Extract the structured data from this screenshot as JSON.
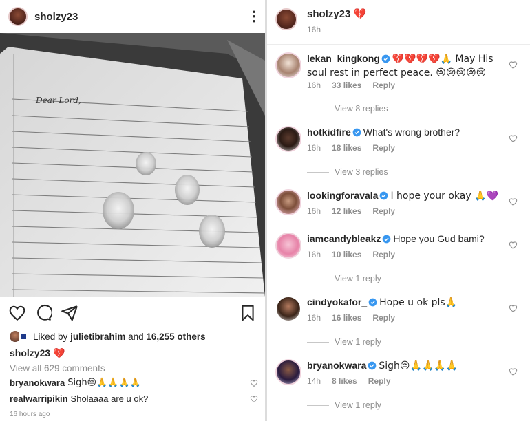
{
  "post": {
    "username": "sholzy23",
    "liked_prefix": "Liked by",
    "liked_user": "julietibrahim",
    "liked_and": "and",
    "liked_others": "16,255 others",
    "caption_user": "sholzy23",
    "caption_emoji": "💔",
    "view_all": "View all 629 comments",
    "preview_comments": [
      {
        "user": "bryanokwara",
        "text": "Sigh😔🙏🙏🙏🙏"
      },
      {
        "user": "realwarripikin",
        "text": "Sholaaaa are u ok?"
      }
    ],
    "time_ago": "16 hours ago",
    "photo_text": "Dear Lord,"
  },
  "detail": {
    "username": "sholzy23",
    "emoji": "💔",
    "time": "16h",
    "comments": [
      {
        "user": "lekan_kingkong",
        "text": "💔💔💔💔🙏 May His soul rest in perfect peace. 😢😢😢😢😢",
        "time": "16h",
        "likes": "33 likes",
        "reply": "Reply",
        "replies": "View 8 replies"
      },
      {
        "user": "hotkidfire",
        "text": "What's wrong brother?",
        "time": "16h",
        "likes": "18 likes",
        "reply": "Reply",
        "replies": "View 3 replies"
      },
      {
        "user": "lookingforavala",
        "text": "I hope your okay 🙏💜",
        "time": "16h",
        "likes": "12 likes",
        "reply": "Reply",
        "replies": ""
      },
      {
        "user": "iamcandybleakz",
        "text": "Hope you Gud bami?",
        "time": "16h",
        "likes": "10 likes",
        "reply": "Reply",
        "replies": "View 1 reply"
      },
      {
        "user": "cindyokafor_",
        "text": "Hope u ok pls🙏",
        "time": "16h",
        "likes": "16 likes",
        "reply": "Reply",
        "replies": "View 1 reply"
      },
      {
        "user": "bryanokwara",
        "text": "Sigh😔🙏🙏🙏🙏",
        "time": "14h",
        "likes": "8 likes",
        "reply": "Reply",
        "replies": "View 1 reply"
      }
    ]
  },
  "colors": {
    "verified": "#3897f0",
    "muted": "#8e8e8e",
    "text": "#262626"
  }
}
